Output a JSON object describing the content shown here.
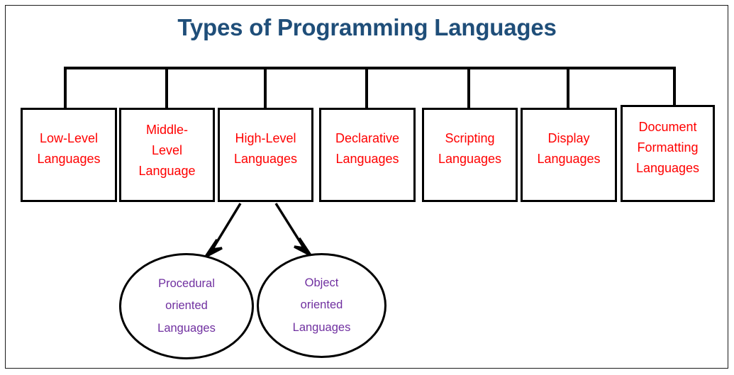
{
  "page": {
    "title": "Types of Programming Languages",
    "title_color": "#1F4E79",
    "box_text_color": "#FF0000",
    "ellipse_text_color": "#7030A0",
    "line_color": "#000000",
    "background": "#FFFFFF"
  },
  "categories": [
    {
      "id": "low-level",
      "lines": [
        "Low-Level",
        "Languages"
      ]
    },
    {
      "id": "middle-level",
      "lines": [
        "Middle-",
        "Level",
        "Language"
      ]
    },
    {
      "id": "high-level",
      "lines": [
        "High-Level",
        "Languages"
      ]
    },
    {
      "id": "declarative",
      "lines": [
        "Declarative",
        "Languages"
      ]
    },
    {
      "id": "scripting",
      "lines": [
        "Scripting",
        "Languages"
      ]
    },
    {
      "id": "display",
      "lines": [
        "Display",
        "Languages"
      ]
    },
    {
      "id": "document-formatting",
      "lines": [
        "Document",
        "Formatting",
        "Languages"
      ]
    }
  ],
  "subcategories": [
    {
      "id": "procedural-oriented",
      "parent": "high-level",
      "lines": [
        "Procedural",
        "oriented",
        "Languages"
      ]
    },
    {
      "id": "object-oriented",
      "parent": "high-level",
      "lines": [
        "Object",
        "oriented",
        "Languages"
      ]
    }
  ]
}
